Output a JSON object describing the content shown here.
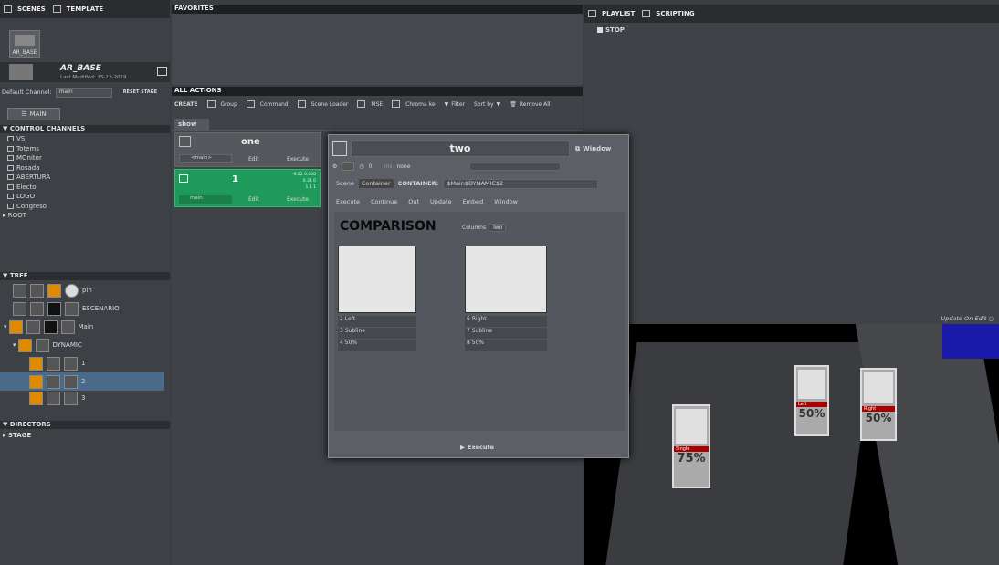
{
  "left": {
    "tabs": [
      "SCENES",
      "TEMPLATE"
    ],
    "thumb_label": "AR_BASE",
    "scene_name": "AR_BASE",
    "last_modified": "Last Modified: 15-12-2019",
    "default_channel_label": "Default Channel:",
    "default_channel_value": "main",
    "reset_stage": "RESET STAGE",
    "main_btn": "MAIN",
    "control_channels_header": "CONTROL CHANNELS",
    "channels": [
      "VS",
      "Totems",
      "MOnitor",
      "Rosada",
      "ABERTURA",
      "Electo",
      "LOGO",
      "Congreso"
    ],
    "root": "ROOT",
    "tree_header": "TREE",
    "tree_items": [
      {
        "label": "pin"
      },
      {
        "label": "ESCENARIO"
      },
      {
        "label": "Main"
      },
      {
        "label": "DYNAMIC"
      },
      {
        "label": "1"
      },
      {
        "label": "2"
      },
      {
        "label": "3"
      }
    ],
    "directors_header": "DIRECTORS",
    "stage": "STAGE"
  },
  "favorites": {
    "title": "FAVORITES"
  },
  "actions": {
    "title": "ALL ACTIONS",
    "create": "CREATE",
    "buttons": [
      "Group",
      "Command",
      "Scene Loader",
      "MSE",
      "Chroma ke",
      "Filter",
      "Sort by",
      "Remove All"
    ],
    "tab": "show",
    "card_one": {
      "title": "one",
      "channel": "<main>",
      "edit": "Edit",
      "execute": "Execute"
    },
    "card_1": {
      "title": "1",
      "channel": "main",
      "edit": "Edit",
      "execute": "Execute",
      "v1": "-0.22 0.000",
      "v2": "0.34 0",
      "v3": "1 1 1"
    }
  },
  "popup": {
    "title": "two",
    "window": "Window",
    "num": "0",
    "unit": "ms",
    "none": "none",
    "scene": "Scene",
    "container": "Container",
    "container_label": "CONTAINER:",
    "container_path": "$Main$DYNAMIC$2",
    "execute": "Execute",
    "continue": "Continue",
    "out": "Out",
    "update": "Update",
    "embed": "Embed",
    "window2": "Window",
    "comparison": "COMPARISON",
    "columns_label": "Columns",
    "columns_value": "Two",
    "left_fields": [
      "Left",
      "Subline",
      "50%"
    ],
    "left_nums": [
      "2",
      "3",
      "4"
    ],
    "right_fields": [
      "Right",
      "Subline",
      "50%"
    ],
    "right_nums": [
      "6",
      "7",
      "8"
    ],
    "footer_execute": "Execute"
  },
  "right": {
    "tabs": [
      "PLAYLIST",
      "SCRIPTING"
    ],
    "stop": "STOP",
    "update_on_edit": "Update On-Edit",
    "cards": [
      {
        "name": "Single",
        "pct": "75%"
      },
      {
        "name": "Left",
        "pct": "50%"
      },
      {
        "name": "Right",
        "pct": "50%"
      }
    ]
  },
  "colors": {
    "accent_green": "#1f9a5a",
    "accent_orange": "#e08a00",
    "viewport_blue": "#1a1aa8"
  }
}
